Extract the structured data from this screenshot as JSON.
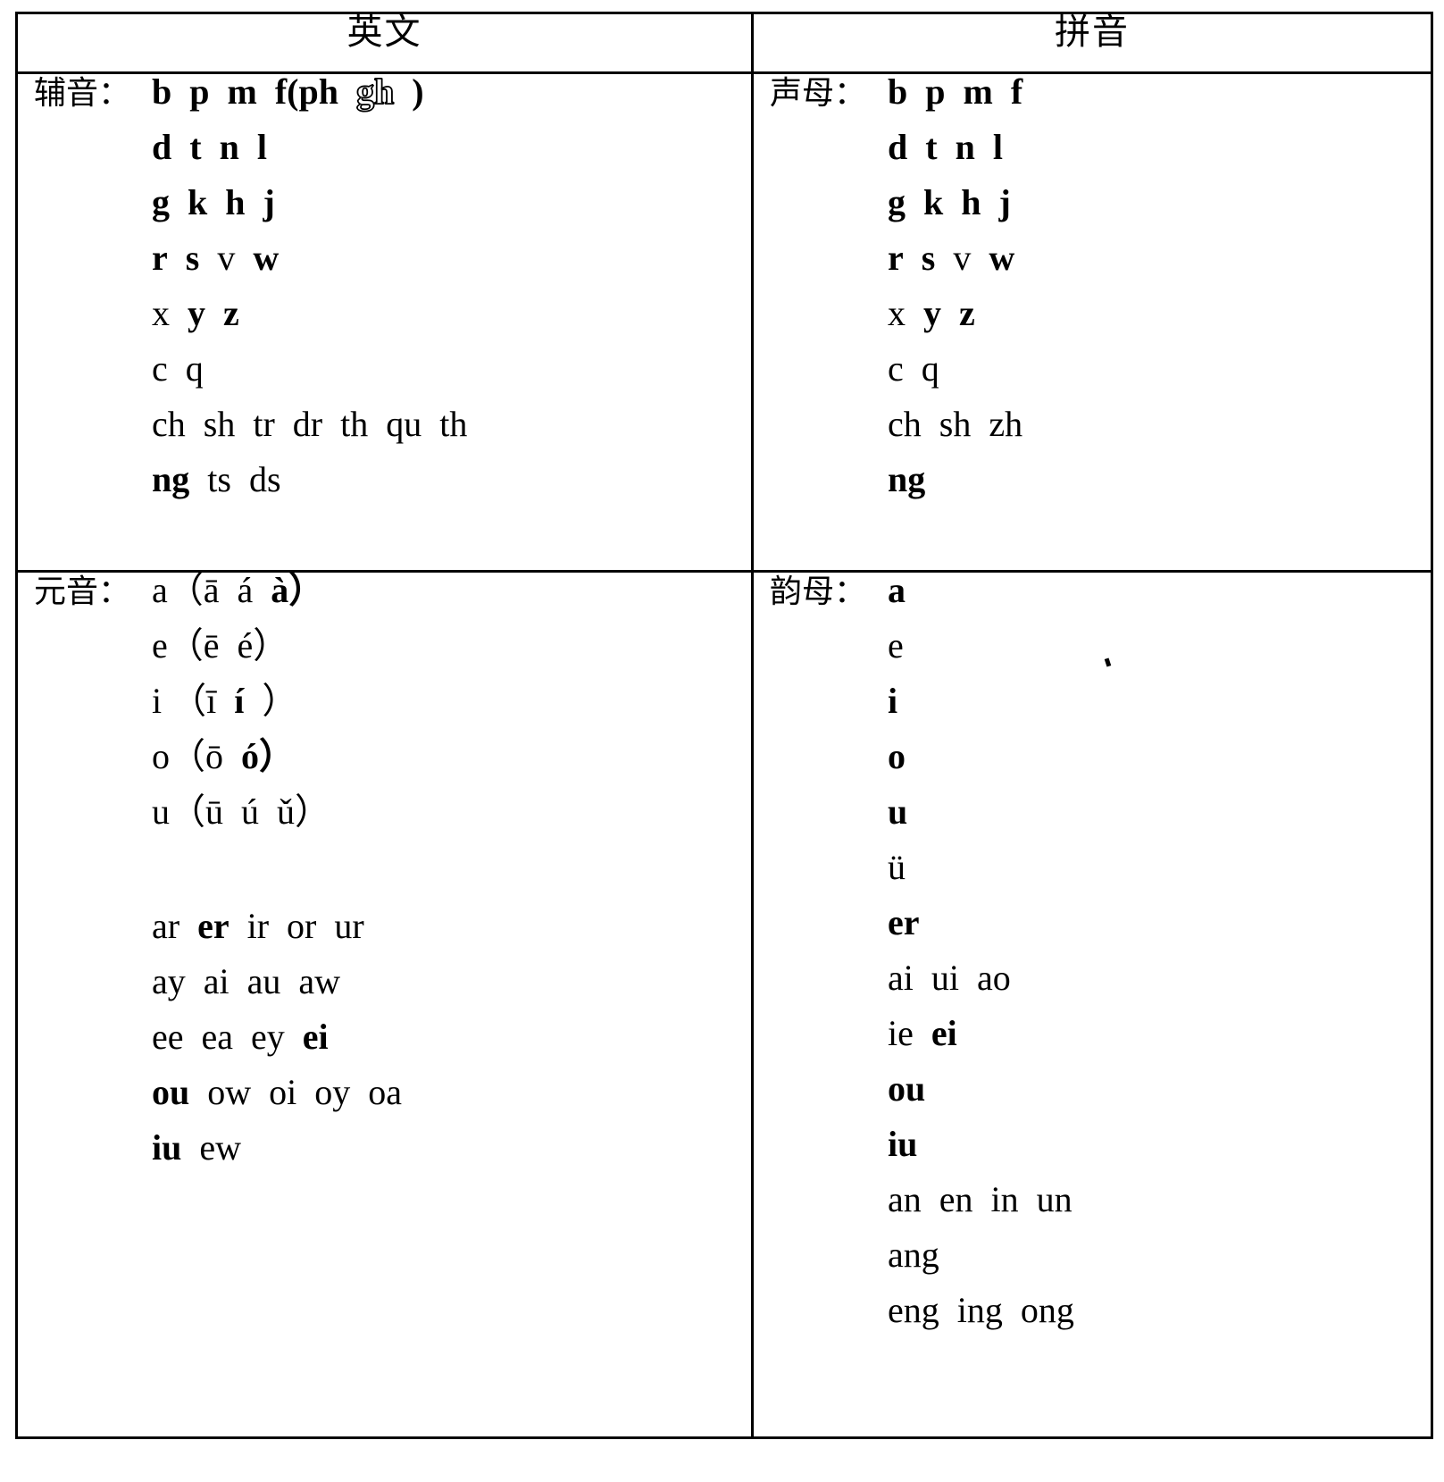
{
  "table": {
    "headers": {
      "left": "英文",
      "right": "拼音"
    },
    "rows": [
      {
        "left": {
          "label": "辅音：",
          "lines": [
            [
              {
                "t": "b",
                "bold": true
              },
              {
                "t": "p",
                "bold": true
              },
              {
                "t": "m",
                "bold": true
              },
              {
                "t": "f(ph",
                "bold": true
              },
              {
                "t": "gh",
                "bold": true,
                "outline": true
              },
              {
                "t": ")",
                "bold": true
              }
            ],
            [
              {
                "t": "d",
                "bold": true
              },
              {
                "t": "t",
                "bold": true
              },
              {
                "t": "n",
                "bold": true
              },
              {
                "t": "l",
                "bold": true
              }
            ],
            [
              {
                "t": "g",
                "bold": true
              },
              {
                "t": "k",
                "bold": true
              },
              {
                "t": "h",
                "bold": true
              },
              {
                "t": "j",
                "bold": true
              }
            ],
            [
              {
                "t": "r",
                "bold": true
              },
              {
                "t": "s",
                "bold": true
              },
              {
                "t": "v",
                "bold": false
              },
              {
                "t": "w",
                "bold": true
              }
            ],
            [
              {
                "t": "x",
                "bold": false
              },
              {
                "t": "y",
                "bold": true
              },
              {
                "t": "z",
                "bold": true
              }
            ],
            [
              {
                "t": "c",
                "bold": false
              },
              {
                "t": "q",
                "bold": false
              }
            ],
            [
              {
                "t": "ch",
                "bold": false
              },
              {
                "t": "sh",
                "bold": false
              },
              {
                "t": "tr",
                "bold": false
              },
              {
                "t": "dr",
                "bold": false
              },
              {
                "t": "th",
                "bold": false
              },
              {
                "t": "qu",
                "bold": false
              },
              {
                "t": "th",
                "bold": false
              }
            ],
            [
              {
                "t": "ng",
                "bold": true
              },
              {
                "t": "ts",
                "bold": false
              },
              {
                "t": "ds",
                "bold": false
              }
            ]
          ]
        },
        "right": {
          "label": "声母：",
          "lines": [
            [
              {
                "t": "b",
                "bold": true
              },
              {
                "t": "p",
                "bold": true
              },
              {
                "t": "m",
                "bold": true
              },
              {
                "t": "f",
                "bold": true
              }
            ],
            [
              {
                "t": "d",
                "bold": true
              },
              {
                "t": "t",
                "bold": true
              },
              {
                "t": "n",
                "bold": true
              },
              {
                "t": "l",
                "bold": true
              }
            ],
            [
              {
                "t": "g",
                "bold": true
              },
              {
                "t": "k",
                "bold": true
              },
              {
                "t": "h",
                "bold": true
              },
              {
                "t": "j",
                "bold": true
              }
            ],
            [
              {
                "t": "r",
                "bold": true
              },
              {
                "t": "s",
                "bold": true
              },
              {
                "t": "v",
                "bold": false
              },
              {
                "t": "w",
                "bold": true
              }
            ],
            [
              {
                "t": "x",
                "bold": false
              },
              {
                "t": "y",
                "bold": true
              },
              {
                "t": "z",
                "bold": true
              }
            ],
            [
              {
                "t": "c",
                "bold": false
              },
              {
                "t": "q",
                "bold": false
              }
            ],
            [
              {
                "t": "ch",
                "bold": false
              },
              {
                "t": "sh",
                "bold": false
              },
              {
                "t": "zh",
                "bold": false
              }
            ],
            [
              {
                "t": "ng",
                "bold": true
              }
            ]
          ]
        }
      },
      {
        "left": {
          "label": "元音：",
          "lines": [
            [
              {
                "t": "a（ā",
                "bold": false
              },
              {
                "t": "á",
                "bold": false
              },
              {
                "t": "à）",
                "bold": true
              }
            ],
            [
              {
                "t": "e（ē",
                "bold": false
              },
              {
                "t": "é）",
                "bold": false
              }
            ],
            [
              {
                "t": "i （ī",
                "bold": false
              },
              {
                "t": "í",
                "bold": true
              },
              {
                "t": "）",
                "bold": false
              }
            ],
            [
              {
                "t": "o（ō",
                "bold": false
              },
              {
                "t": "ó）",
                "bold": true
              }
            ],
            [
              {
                "t": "u（ū",
                "bold": false
              },
              {
                "t": "ú",
                "bold": false
              },
              {
                "t": "ǔ）",
                "bold": false
              }
            ],
            [],
            [
              {
                "t": "ar",
                "bold": false
              },
              {
                "t": "er",
                "bold": true
              },
              {
                "t": "ir",
                "bold": false
              },
              {
                "t": "or",
                "bold": false
              },
              {
                "t": "ur",
                "bold": false
              }
            ],
            [
              {
                "t": "ay",
                "bold": false
              },
              {
                "t": "ai",
                "bold": false
              },
              {
                "t": "au",
                "bold": false
              },
              {
                "t": "aw",
                "bold": false
              }
            ],
            [
              {
                "t": "ee",
                "bold": false
              },
              {
                "t": "ea",
                "bold": false
              },
              {
                "t": "ey",
                "bold": false
              },
              {
                "t": "ei",
                "bold": true
              }
            ],
            [
              {
                "t": "ou",
                "bold": true
              },
              {
                "t": "ow",
                "bold": false
              },
              {
                "t": "oi",
                "bold": false
              },
              {
                "t": "oy",
                "bold": false
              },
              {
                "t": "oa",
                "bold": false
              }
            ],
            [
              {
                "t": "iu",
                "bold": true
              },
              {
                "t": "ew",
                "bold": false
              }
            ]
          ]
        },
        "right": {
          "label": "韵母：",
          "lines": [
            [
              {
                "t": "a",
                "bold": true
              }
            ],
            [
              {
                "t": "e",
                "bold": false
              }
            ],
            [
              {
                "t": "i",
                "bold": true
              }
            ],
            [
              {
                "t": "o",
                "bold": true
              }
            ],
            [
              {
                "t": "u",
                "bold": true
              }
            ],
            [
              {
                "t": "ü",
                "bold": false
              }
            ],
            [
              {
                "t": "er",
                "bold": true
              }
            ],
            [
              {
                "t": "ai",
                "bold": false
              },
              {
                "t": "ui",
                "bold": false
              },
              {
                "t": "ao",
                "bold": false
              }
            ],
            [
              {
                "t": "ie",
                "bold": false
              },
              {
                "t": "ei",
                "bold": true
              }
            ],
            [
              {
                "t": "ou",
                "bold": true
              }
            ],
            [
              {
                "t": "iu",
                "bold": true
              }
            ],
            [
              {
                "t": "an",
                "bold": false
              },
              {
                "t": "en",
                "bold": false
              },
              {
                "t": "in",
                "bold": false
              },
              {
                "t": "un",
                "bold": false
              }
            ],
            [
              {
                "t": "ang",
                "bold": false
              }
            ],
            [
              {
                "t": "eng",
                "bold": false
              },
              {
                "t": "ing",
                "bold": false
              },
              {
                "t": "ong",
                "bold": false
              }
            ]
          ]
        }
      }
    ]
  }
}
